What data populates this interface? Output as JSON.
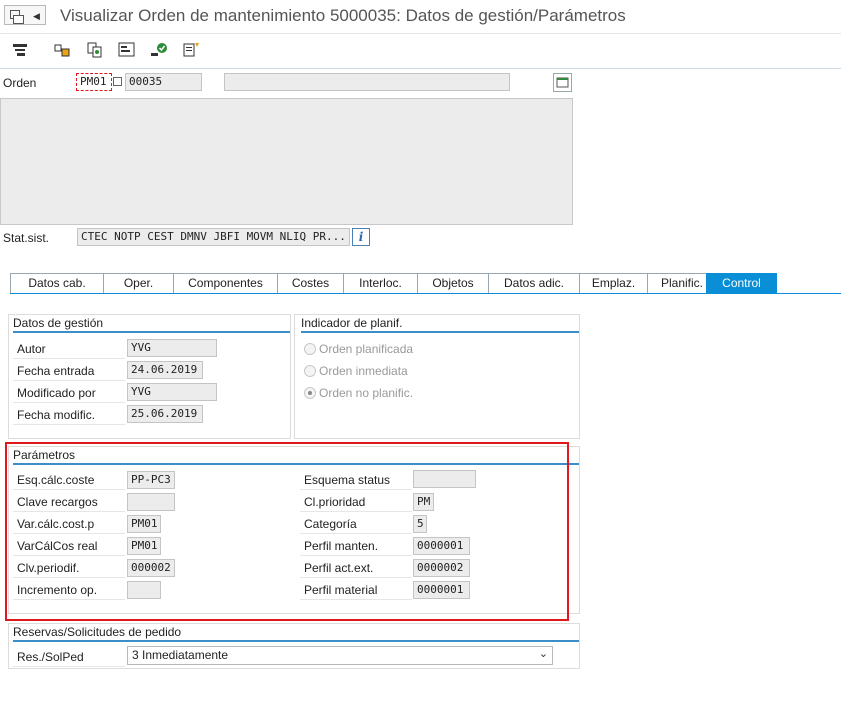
{
  "window": {
    "title": "Visualizar Orden de mantenimiento 5000035: Datos de gestión/Parámetros"
  },
  "toolbar": {
    "icons": [
      "display-change-icon",
      "partner-icon",
      "copy-icon",
      "structure-icon",
      "release-icon",
      "status-doc-icon"
    ]
  },
  "header": {
    "orden_label": "Orden",
    "orden_type": "PM01",
    "orden_number": "00035",
    "orden_text": "",
    "stat_sist_label": "Stat.sist.",
    "stat_sist_value": "CTEC NOTP CEST DMNV JBFI MOVM NLIQ PR..."
  },
  "tabs": [
    {
      "label": "Datos cab."
    },
    {
      "label": "Oper."
    },
    {
      "label": "Componentes"
    },
    {
      "label": "Costes"
    },
    {
      "label": "Interloc."
    },
    {
      "label": "Objetos"
    },
    {
      "label": "Datos adic."
    },
    {
      "label": "Emplaz."
    },
    {
      "label": "Planific."
    },
    {
      "label": "Control"
    }
  ],
  "active_tab": "Control",
  "datos_gestion": {
    "title": "Datos de gestión",
    "rows": [
      {
        "label": "Autor",
        "value": "YVG"
      },
      {
        "label": "Fecha entrada",
        "value": "24.06.2019"
      },
      {
        "label": "Modificado por",
        "value": "YVG"
      },
      {
        "label": "Fecha modific.",
        "value": "25.06.2019"
      }
    ]
  },
  "indicador_planif": {
    "title": "Indicador de planif.",
    "options": [
      {
        "label": "Orden planificada",
        "selected": false
      },
      {
        "label": "Orden inmediata",
        "selected": false
      },
      {
        "label": "Orden no planific.",
        "selected": true
      }
    ]
  },
  "parametros": {
    "title": "Parámetros",
    "left": [
      {
        "label": "Esq.cálc.coste",
        "value": "PP-PC3"
      },
      {
        "label": "Clave recargos",
        "value": ""
      },
      {
        "label": "Var.cálc.cost.p",
        "value": "PM01"
      },
      {
        "label": "VarCálCos real",
        "value": "PM01"
      },
      {
        "label": "Clv.periodif.",
        "value": "000002"
      },
      {
        "label": "Incremento op.",
        "value": ""
      }
    ],
    "right": [
      {
        "label": "Esquema status",
        "value": ""
      },
      {
        "label": "Cl.prioridad",
        "value": "PM"
      },
      {
        "label": "Categoría",
        "value": "5"
      },
      {
        "label": "Perfil manten.",
        "value": "0000001"
      },
      {
        "label": "Perfil act.ext.",
        "value": "0000002"
      },
      {
        "label": "Perfil material",
        "value": "0000001"
      }
    ]
  },
  "reservas": {
    "title": "Reservas/Solicitudes de pedido",
    "label": "Res./SolPed",
    "value": "3 Inmediatamente"
  },
  "colors": {
    "accent": "#0a8fd6",
    "highlight_border": "#e0171d",
    "field_bg": "#ececec"
  }
}
